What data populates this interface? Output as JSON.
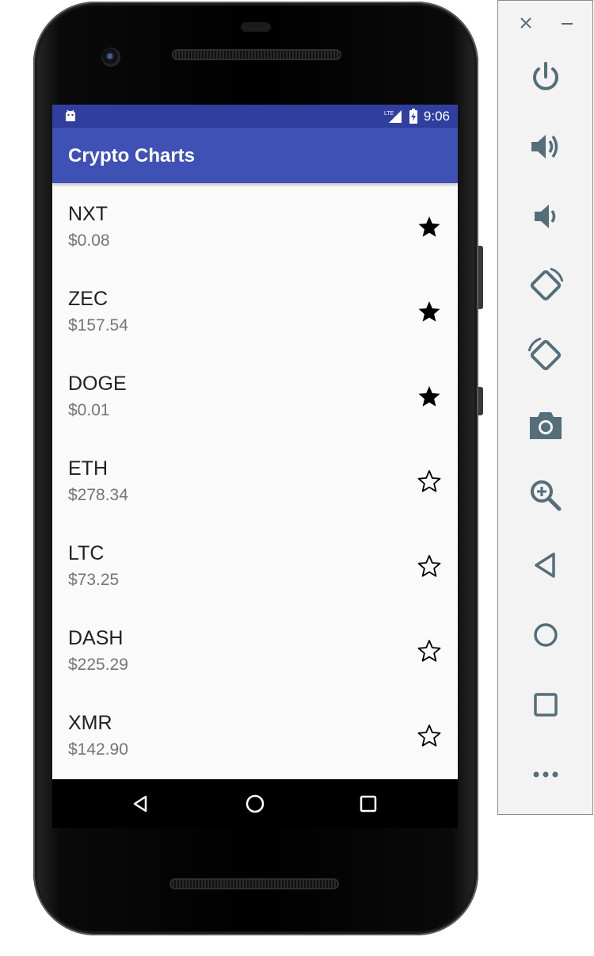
{
  "app": {
    "title": "Crypto Charts"
  },
  "status_bar": {
    "time": "9:06",
    "network": "LTE"
  },
  "coins": [
    {
      "symbol": "NXT",
      "price": "$0.08",
      "favorite": true
    },
    {
      "symbol": "ZEC",
      "price": "$157.54",
      "favorite": true
    },
    {
      "symbol": "DOGE",
      "price": "$0.01",
      "favorite": true
    },
    {
      "symbol": "ETH",
      "price": "$278.34",
      "favorite": false
    },
    {
      "symbol": "LTC",
      "price": "$73.25",
      "favorite": false
    },
    {
      "symbol": "DASH",
      "price": "$225.29",
      "favorite": false
    },
    {
      "symbol": "XMR",
      "price": "$142.90",
      "favorite": false
    }
  ],
  "nav_bar": {
    "icons": [
      "back-icon",
      "home-icon",
      "recents-icon"
    ]
  },
  "emulator_panel": {
    "window_controls": [
      "close-icon",
      "minimize-icon"
    ],
    "tools": [
      "power-icon",
      "volume-up-icon",
      "volume-down-icon",
      "rotate-left-icon",
      "rotate-right-icon",
      "camera-icon",
      "zoom-icon",
      "back-icon",
      "home-icon",
      "overview-icon",
      "more-icon"
    ]
  },
  "colors": {
    "status_bar": "#303f9f",
    "toolbar": "#3f51b5",
    "list_background": "#fafafa",
    "name_text": "#212121",
    "price_text": "#757575",
    "panel_icon": "#546e7a"
  }
}
